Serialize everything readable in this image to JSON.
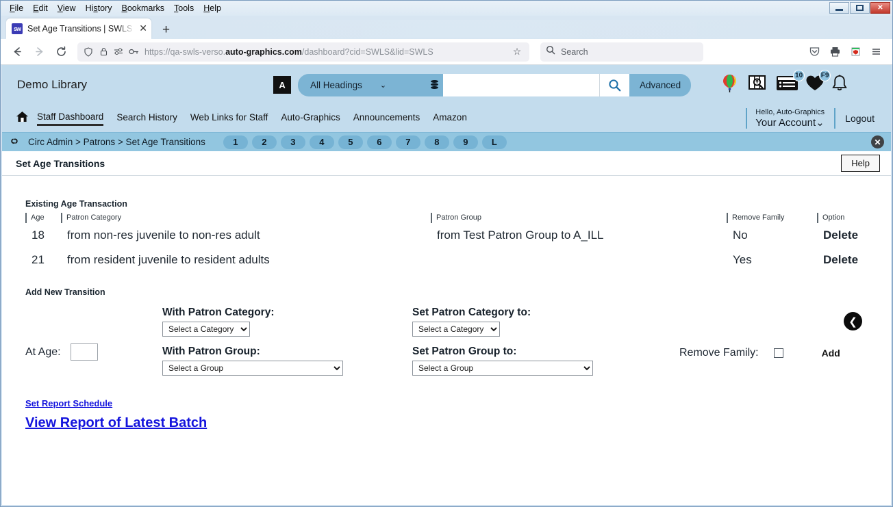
{
  "browser": {
    "menus": [
      "File",
      "Edit",
      "View",
      "History",
      "Bookmarks",
      "Tools",
      "Help"
    ],
    "window_controls": {
      "minimize": "minimize-icon",
      "maximize": "maximize-icon",
      "close": "✕"
    },
    "tab": {
      "title": "Set Age Transitions | SWLS | swls",
      "favicon": "sw",
      "close": "✕",
      "newtab": "+"
    },
    "nav": {
      "back": "←",
      "forward": "→",
      "reload": "⟳",
      "shield": "shield-icon",
      "lock": "lock-icon",
      "permissions": "permissions-icon",
      "key": "key-icon",
      "url_prefix": "https://qa-swls-verso.",
      "url_domain": "auto-graphics.com",
      "url_suffix": "/dashboard?cid=SWLS&lid=SWLS",
      "bookmark_star": "☆",
      "search_placeholder": "Search",
      "pocket": "pocket-icon",
      "print": "print-icon",
      "extension": "extension-icon",
      "menu": "≡"
    }
  },
  "app": {
    "library_name": "Demo Library",
    "search": {
      "lang_icon": "A",
      "heading_scope": "All Headings",
      "chevron": "⌄",
      "database_icon": "database-icon",
      "query": "",
      "go_icon": "search-icon",
      "advanced_label": "Advanced"
    },
    "header_icons": {
      "balloon": "balloon-icon",
      "explore": "explore-icon",
      "list_badge": "10",
      "heart_badge": "F9",
      "bell": "bell-icon"
    },
    "nav": {
      "home_icon": "home-icon",
      "links": [
        {
          "label": "Staff Dashboard",
          "active": true
        },
        {
          "label": "Search History",
          "active": false
        },
        {
          "label": "Web Links for Staff",
          "active": false
        },
        {
          "label": "Auto-Graphics",
          "active": false
        },
        {
          "label": "Announcements",
          "active": false
        },
        {
          "label": "Amazon",
          "active": false
        }
      ]
    },
    "account": {
      "hello": "Hello, Auto-Graphics",
      "name": "Your Account",
      "chevron": "⌄",
      "logout": "Logout"
    },
    "breadcrumb": {
      "chain_icon": "link-icon",
      "path": "Circ Admin > Patrons > Set Age Transitions",
      "pills": [
        "1",
        "2",
        "3",
        "4",
        "5",
        "6",
        "7",
        "8",
        "9",
        "L"
      ],
      "close": "✕"
    },
    "page": {
      "title": "Set Age Transitions",
      "help_label": "Help"
    }
  },
  "existing": {
    "section_label": "Existing Age Transaction",
    "columns": [
      "Age",
      "Patron Category",
      "Patron Group",
      "Remove Family",
      "Option"
    ],
    "rows": [
      {
        "age": "18",
        "patron_category": "from non-res juvenile to non-res adult",
        "patron_group": "from Test Patron Group to A_ILL",
        "remove_family": "No",
        "option": "Delete"
      },
      {
        "age": "21",
        "patron_category": "from resident juvenile to resident adults",
        "patron_group": "",
        "remove_family": "Yes",
        "option": "Delete"
      }
    ]
  },
  "add_form": {
    "section_label": "Add New Transition",
    "age_label": "At Age:",
    "age_value": "",
    "with_category_label": "With Patron Category:",
    "with_category_value": "Select a Category",
    "with_group_label": "With Patron Group:",
    "with_group_value": "Select a Group",
    "set_category_label": "Set Patron Category to:",
    "set_category_value": "Select a Category",
    "set_group_label": "Set Patron Group to:",
    "set_group_value": "Select a Group",
    "remove_family_label": "Remove Family:",
    "remove_family_checked": false,
    "add_label": "Add",
    "back_icon": "❮"
  },
  "footer_links": {
    "schedule": "Set Report Schedule",
    "latest_batch": "View Report of Latest Batch"
  },
  "colors": {
    "app_header_bg": "#c3dced",
    "accent_pill": "#7cb4d4",
    "breadcrumb_bg": "#92c6e0",
    "link_blue": "#1414dd",
    "close_red": "#c2382b"
  }
}
